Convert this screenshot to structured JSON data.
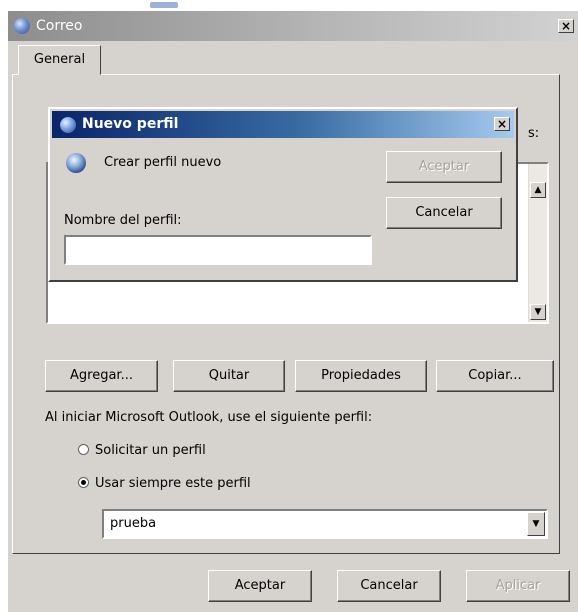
{
  "window": {
    "title": "Correo",
    "close_glyph": "×",
    "tabs": [
      {
        "label": "General"
      }
    ]
  },
  "profile_list": {
    "partial_label": "s:"
  },
  "buttons": {
    "add": "Agregar...",
    "remove": "Quitar",
    "properties": "Propiedades",
    "copy": "Copiar..."
  },
  "startup": {
    "prompt_label": "Al iniciar Microsoft Outlook, use el siguiente perfil:",
    "options": [
      {
        "label": "Solicitar un perfil",
        "selected": false
      },
      {
        "label": "Usar siempre este perfil",
        "selected": true
      }
    ],
    "profile_value": "prueba"
  },
  "footer": {
    "ok": "Aceptar",
    "cancel": "Cancelar",
    "apply": "Aplicar"
  },
  "dialog": {
    "title": "Nuevo perfil",
    "create_label": "Crear perfil nuevo",
    "name_label": "Nombre del perfil:",
    "name_value": "",
    "ok": "Aceptar",
    "cancel": "Cancelar"
  },
  "icons": {
    "window_icon": "mail-globe-icon",
    "dialog_icon": "mail-globe-icon",
    "create_icon": "globe-icon"
  },
  "colors": {
    "face": "#d6d3ce",
    "inactive_title": "#8d8d8d",
    "active_title": "#0a246a"
  }
}
